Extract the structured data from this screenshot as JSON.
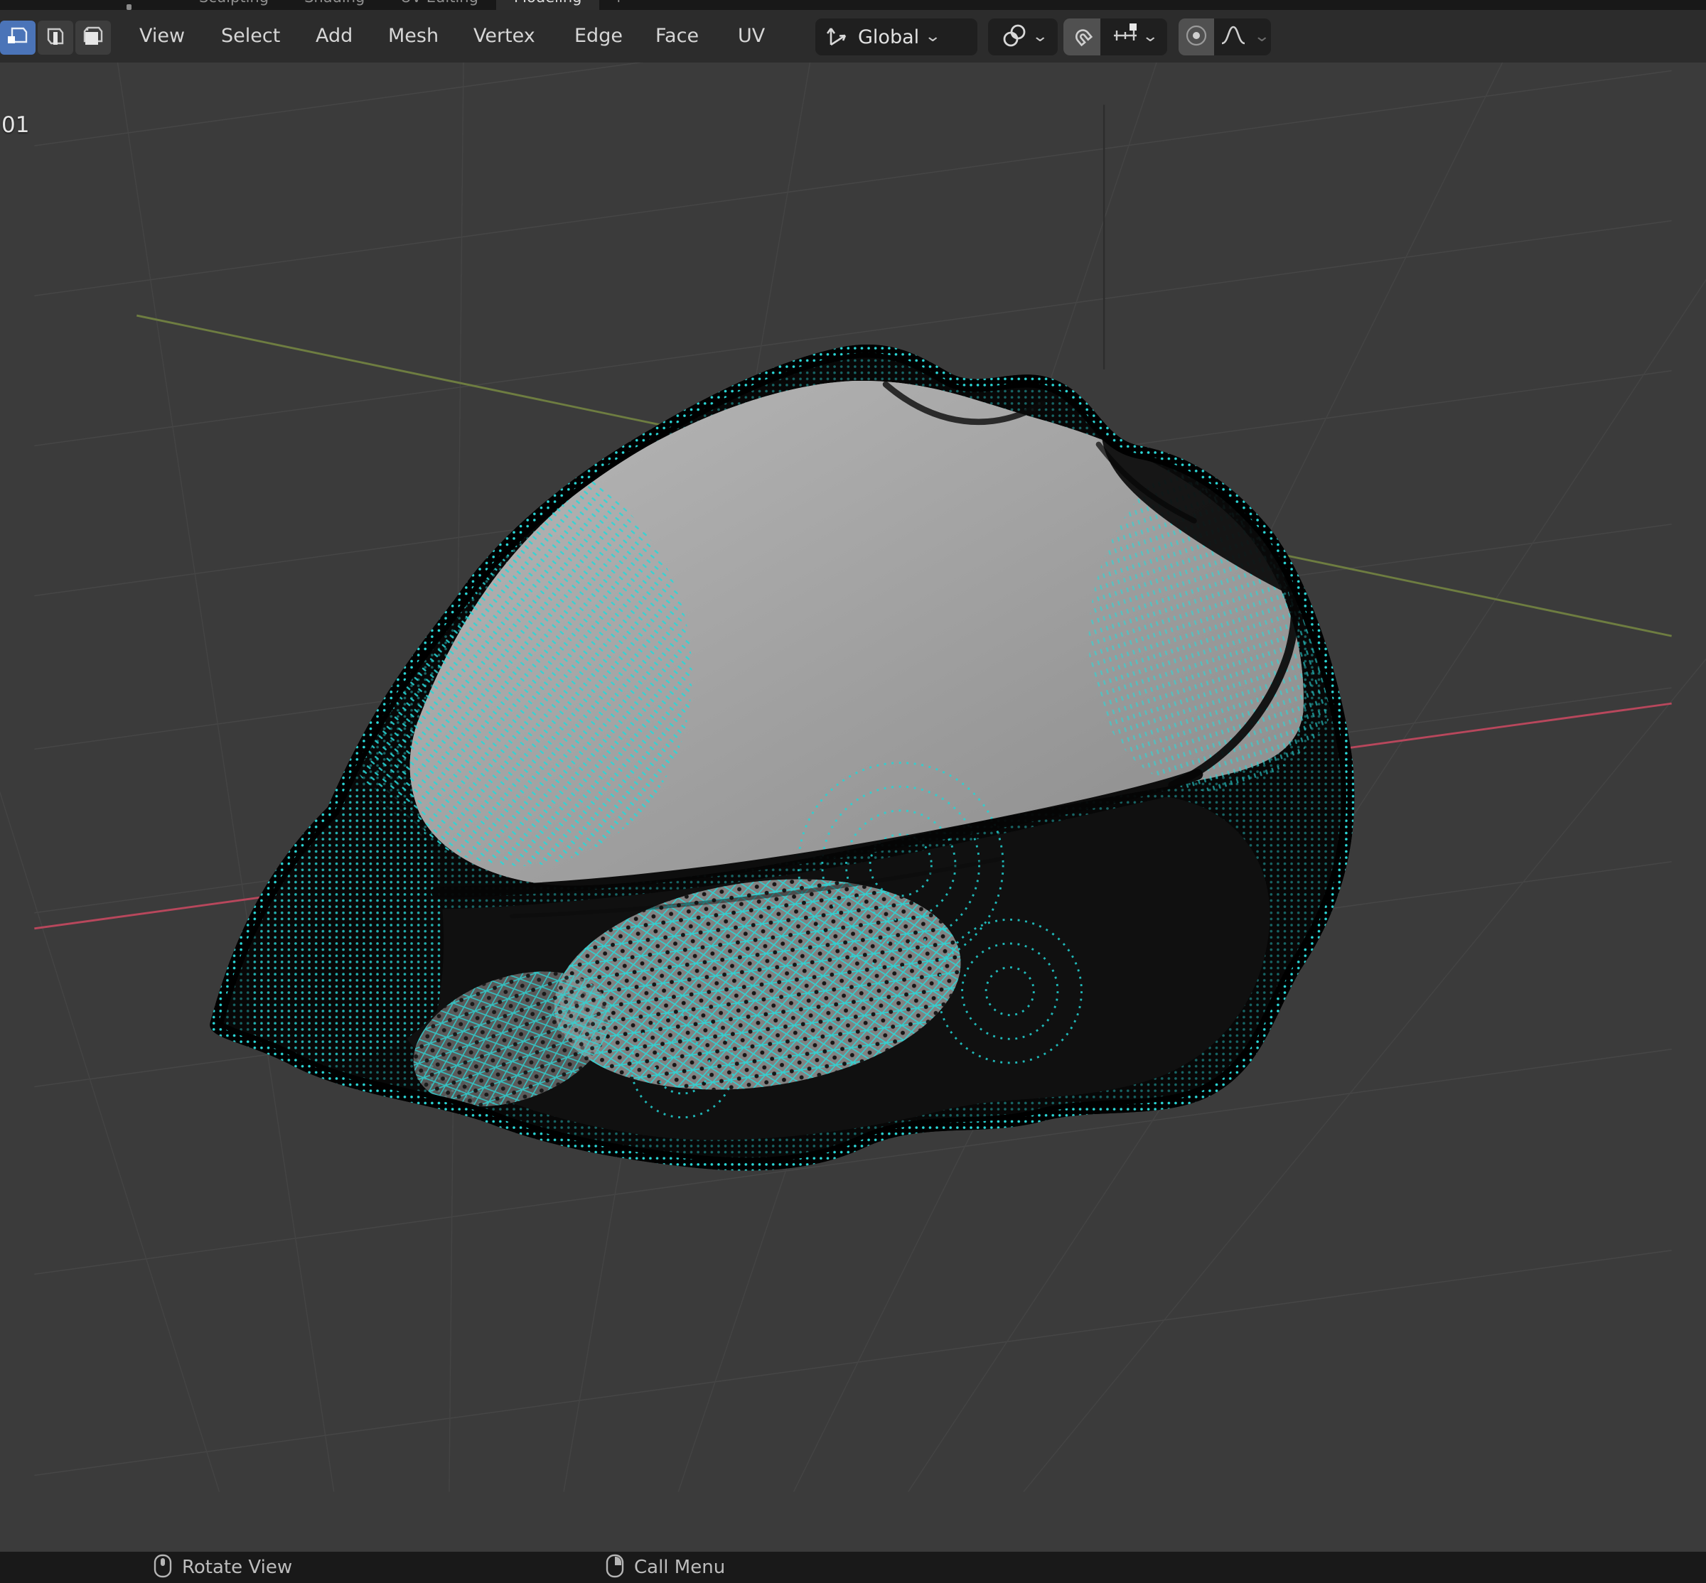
{
  "app": "Blender",
  "workspace_tabs": {
    "items": [
      {
        "label": "Sculpting",
        "active": false
      },
      {
        "label": "Shading",
        "active": false
      },
      {
        "label": "UV Editing",
        "active": false
      },
      {
        "label": "Modeling",
        "active": true
      },
      {
        "label": "+",
        "active": false
      }
    ]
  },
  "header": {
    "select_modes": [
      {
        "icon": "vertex-select-icon",
        "active": true
      },
      {
        "icon": "edge-select-icon",
        "active": false
      },
      {
        "icon": "face-select-icon",
        "active": false
      }
    ],
    "menus": [
      "View",
      "Select",
      "Add",
      "Mesh",
      "Vertex",
      "Edge",
      "Face",
      "UV"
    ],
    "transform_orientation": {
      "value": "Global"
    },
    "toggles": {
      "snap_enabled": true,
      "proportional_editing_enabled": true
    }
  },
  "viewport": {
    "object_label_fragment": "01",
    "mode": "Edit Mode mesh with dense cyan wireframe"
  },
  "status_bar": {
    "items": [
      {
        "icon": "mouse-middle-icon",
        "label": "Rotate View"
      },
      {
        "icon": "mouse-right-icon",
        "label": "Call Menu"
      }
    ]
  },
  "colors": {
    "accent-blue": "#4b74b8",
    "viewport-bg": "#3b3b3b",
    "grid-line": "#464646",
    "axis-red": "#b8475c",
    "axis-green": "#6e7d41",
    "wire-cyan": "#2bd8d8",
    "face-gray": "#9c9c9c",
    "mesh-dark": "#070707"
  }
}
